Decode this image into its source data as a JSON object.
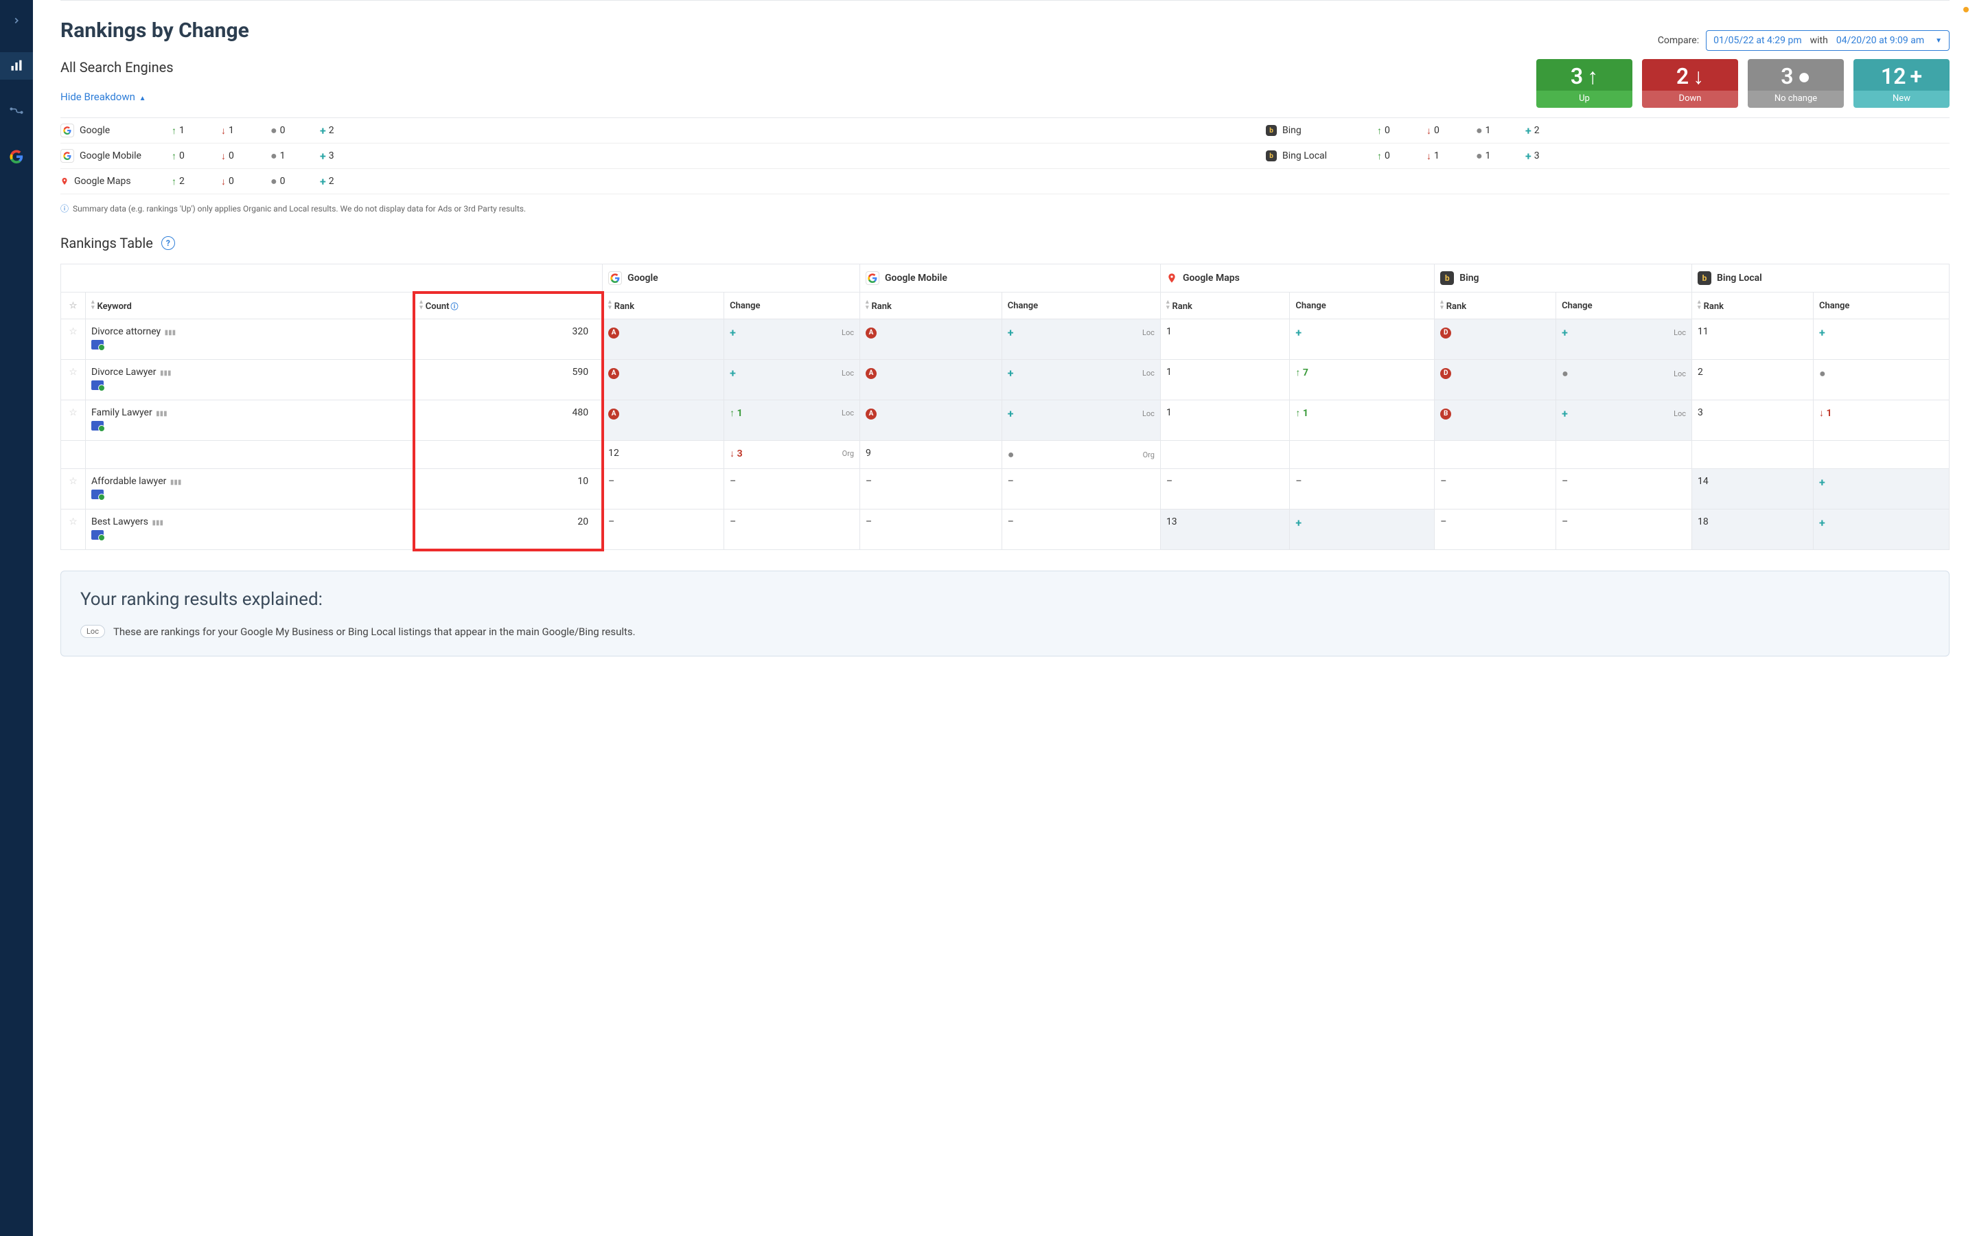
{
  "page_title": "Rankings by Change",
  "compare": {
    "label": "Compare:",
    "date1": "01/05/22 at 4:29 pm",
    "with": "with",
    "date2": "04/20/20 at 9:09 am"
  },
  "all_engines_label": "All Search Engines",
  "hide_breakdown_label": "Hide Breakdown",
  "cards": {
    "up": {
      "value": "3",
      "label": "Up"
    },
    "down": {
      "value": "2",
      "label": "Down"
    },
    "nochange": {
      "value": "3",
      "label": "No change"
    },
    "newc": {
      "value": "12",
      "label": "New"
    }
  },
  "breakdown_left": [
    {
      "name": "Google",
      "up": "1",
      "down": "1",
      "same": "0",
      "new": "2",
      "icon": "google"
    },
    {
      "name": "Google Mobile",
      "up": "0",
      "down": "0",
      "same": "1",
      "new": "3",
      "icon": "google"
    },
    {
      "name": "Google Maps",
      "up": "2",
      "down": "0",
      "same": "0",
      "new": "2",
      "icon": "maps"
    }
  ],
  "breakdown_right": [
    {
      "name": "Bing",
      "up": "0",
      "down": "0",
      "same": "1",
      "new": "2",
      "icon": "bing"
    },
    {
      "name": "Bing Local",
      "up": "0",
      "down": "1",
      "same": "1",
      "new": "3",
      "icon": "bing"
    }
  ],
  "summary_note": "Summary data (e.g. rankings 'Up') only applies Organic and Local results. We do not display data for Ads or 3rd Party results.",
  "rankings_table_label": "Rankings Table",
  "engine_headers": [
    "Google",
    "Google Mobile",
    "Google Maps",
    "Bing",
    "Bing Local"
  ],
  "columns": {
    "keyword": "Keyword",
    "count": "Count",
    "rank": "Rank",
    "change": "Change"
  },
  "tags": {
    "loc": "Loc",
    "org": "Org"
  },
  "rows": [
    {
      "keyword": "Divorce attorney",
      "count": "320",
      "google": {
        "rank_badge": "A",
        "change": "+",
        "tag": "Loc"
      },
      "google_mobile": {
        "rank_badge": "A",
        "change": "+",
        "tag": "Loc"
      },
      "google_maps": {
        "rank": "1",
        "change": "+"
      },
      "bing": {
        "rank_badge": "D",
        "change": "+",
        "tag": "Loc"
      },
      "bing_local": {
        "rank": "11",
        "change": "+"
      }
    },
    {
      "keyword": "Divorce Lawyer",
      "count": "590",
      "google": {
        "rank_badge": "A",
        "change": "+",
        "tag": "Loc"
      },
      "google_mobile": {
        "rank_badge": "A",
        "change": "+",
        "tag": "Loc"
      },
      "google_maps": {
        "rank": "1",
        "change_up": "7"
      },
      "bing": {
        "rank_badge": "D",
        "change_dot": true,
        "tag": "Loc"
      },
      "bing_local": {
        "rank": "2",
        "change_dot": true
      }
    },
    {
      "keyword": "Family Lawyer",
      "count": "480",
      "google": {
        "rank_badge": "A",
        "change_up": "1",
        "tag": "Loc"
      },
      "google_mobile": {
        "rank_badge": "A",
        "change": "+",
        "tag": "Loc"
      },
      "google_maps": {
        "rank": "1",
        "change_up": "1"
      },
      "bing": {
        "rank_badge": "B",
        "change": "+",
        "tag": "Loc"
      },
      "bing_local": {
        "rank": "3",
        "change_down": "1"
      },
      "sub": {
        "google": {
          "rank": "12",
          "change_down": "3",
          "tag": "Org"
        },
        "google_mobile": {
          "rank": "9",
          "change_dot": true,
          "tag": "Org"
        }
      }
    },
    {
      "keyword": "Affordable lawyer",
      "count": "10",
      "google": {
        "rank": "–",
        "change": "–"
      },
      "google_mobile": {
        "rank": "–",
        "change": "–"
      },
      "google_maps": {
        "rank": "–",
        "change": "–"
      },
      "bing": {
        "rank": "–",
        "change": "–"
      },
      "bing_local": {
        "rank": "14",
        "change": "+"
      }
    },
    {
      "keyword": "Best Lawyers",
      "count": "20",
      "google": {
        "rank": "–",
        "change": "–"
      },
      "google_mobile": {
        "rank": "–",
        "change": "–"
      },
      "google_maps": {
        "rank": "13",
        "change": "+"
      },
      "bing": {
        "rank": "–",
        "change": "–"
      },
      "bing_local": {
        "rank": "18",
        "change": "+"
      }
    }
  ],
  "explain": {
    "title": "Your ranking results explained:",
    "loc_text": "These are rankings for your Google My Business or Bing Local listings that appear in the main Google/Bing results."
  }
}
